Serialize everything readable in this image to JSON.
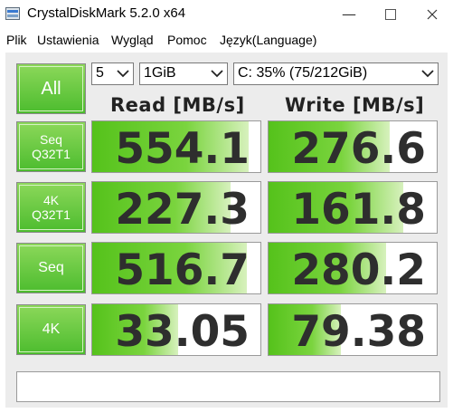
{
  "window": {
    "title": "CrystalDiskMark 5.2.0 x64"
  },
  "menu": [
    "Plik",
    "Ustawienia",
    "Wygląd",
    "Pomoc",
    "Język(Language)"
  ],
  "controls": {
    "all_label": "All",
    "count": "5",
    "size": "1GiB",
    "drive": "C: 35% (75/212GiB)"
  },
  "headers": {
    "read": "Read [MB/s]",
    "write": "Write [MB/s]"
  },
  "tests": [
    {
      "line1": "Seq",
      "line2": "Q32T1",
      "read": "554.1",
      "write": "276.6",
      "read_fill": 0.93,
      "write_fill": 0.72
    },
    {
      "line1": "4K",
      "line2": "Q32T1",
      "read": "227.3",
      "write": "161.8",
      "read_fill": 0.82,
      "write_fill": 0.8
    },
    {
      "line1": "Seq",
      "line2": "",
      "read": "516.7",
      "write": "280.2",
      "read_fill": 0.92,
      "write_fill": 0.7
    },
    {
      "line1": "4K",
      "line2": "",
      "read": "33.05",
      "write": "79.38",
      "read_fill": 0.51,
      "write_fill": 0.43
    }
  ],
  "comment": "",
  "colors": {
    "tile_green": "#4cbc2e",
    "bar_green": "#55c21b",
    "background": "#ececec"
  },
  "icons": [
    "app-icon",
    "minimize-icon",
    "maximize-icon",
    "close-icon",
    "chevron-down-icon"
  ]
}
